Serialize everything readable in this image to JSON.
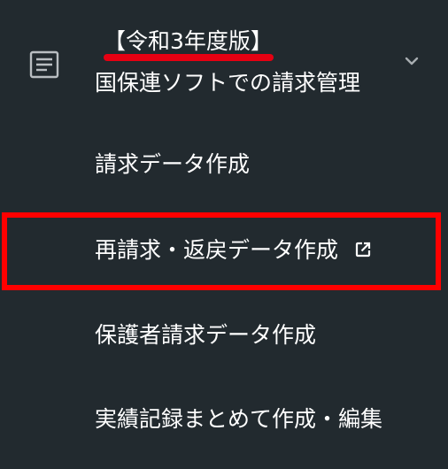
{
  "header": {
    "section_icon": "document-icon",
    "title": "【令和3年度版】",
    "underline_color": "#e60012",
    "collapse_icon": "chevron-down-icon"
  },
  "menu": {
    "items": [
      {
        "label": "国保連ソフトでの請求管理"
      },
      {
        "label": "請求データ作成"
      },
      {
        "label": "再請求・返戻データ作成",
        "icon": "external-link-icon",
        "highlighted": true
      },
      {
        "label": "保護者請求データ作成"
      },
      {
        "label": "実績記録まとめて作成・編集"
      }
    ]
  },
  "colors": {
    "background": "#222a2f",
    "text": "#ffffff",
    "highlight_border": "#ff0000"
  }
}
